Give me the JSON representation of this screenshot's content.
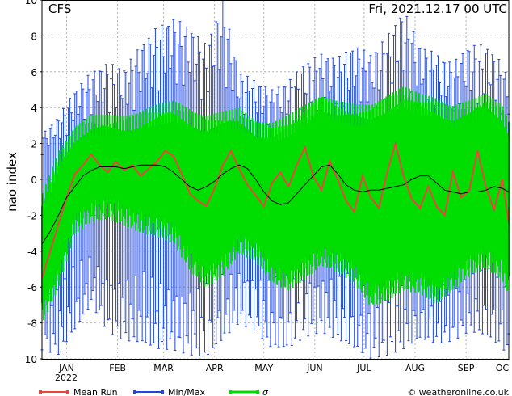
{
  "header": {
    "model": "CFS",
    "run_stamp": "Fri, 2021.12.17   00 UTC"
  },
  "footer": {
    "credit": "© weatheronline.co.uk"
  },
  "colors": {
    "mean": "#e8463c",
    "minmax": "#1e46e6",
    "sigma": "#00dd00",
    "ensemble_mean": "#000000",
    "grid": "#b4b4b4"
  },
  "chart_data": {
    "type": "line",
    "ylabel": "nao index",
    "ylim": [
      -10,
      10
    ],
    "y_ticks": [
      -10,
      -8,
      -6,
      -4,
      -2,
      0,
      2,
      4,
      6,
      8,
      10
    ],
    "xlim_days": [
      0,
      284
    ],
    "x_ticks": [
      {
        "label": "JAN",
        "day": 15
      },
      {
        "label": "FEB",
        "day": 46
      },
      {
        "label": "MAR",
        "day": 74
      },
      {
        "label": "APR",
        "day": 105
      },
      {
        "label": "MAY",
        "day": 135
      },
      {
        "label": "JUN",
        "day": 166
      },
      {
        "label": "JUL",
        "day": 196
      },
      {
        "label": "AUG",
        "day": 227
      },
      {
        "label": "SEP",
        "day": 258
      },
      {
        "label": "OC",
        "day": 288
      }
    ],
    "x_sublabel": "2022",
    "legend": [
      "Mean Run",
      "Min/Max",
      "σ"
    ],
    "series": [
      {
        "name": "Mean Run",
        "day": [
          0,
          5,
          10,
          15,
          20,
          25,
          30,
          35,
          40,
          45,
          50,
          55,
          60,
          65,
          70,
          75,
          80,
          85,
          90,
          95,
          100,
          105,
          110,
          115,
          120,
          125,
          130,
          135,
          140,
          145,
          150,
          155,
          160,
          165,
          170,
          175,
          180,
          185,
          190,
          195,
          200,
          205,
          210,
          215,
          220,
          225,
          230,
          235,
          240,
          245,
          250,
          255,
          260,
          265,
          270,
          275,
          280,
          284
        ],
        "values": [
          -5.5,
          -4.0,
          -2.5,
          -1.0,
          0.3,
          0.8,
          1.4,
          0.8,
          0.4,
          1.0,
          0.5,
          0.8,
          0.2,
          0.6,
          1.0,
          1.6,
          1.3,
          0.3,
          -0.8,
          -1.2,
          -1.5,
          -0.5,
          0.8,
          1.6,
          0.6,
          -0.3,
          -0.9,
          -1.5,
          -0.2,
          0.4,
          -0.4,
          0.8,
          1.8,
          0.2,
          -0.6,
          1.0,
          0.0,
          -1.2,
          -1.8,
          0.2,
          -1.0,
          -1.6,
          0.4,
          2.0,
          0.2,
          -1.1,
          -1.6,
          -0.4,
          -1.5,
          -2.0,
          0.4,
          -1.0,
          -0.6,
          1.6,
          -0.4,
          -1.7,
          0.0,
          -2.4
        ]
      },
      {
        "name": "ensemble mean",
        "day": [
          0,
          5,
          10,
          15,
          20,
          25,
          30,
          35,
          40,
          45,
          50,
          55,
          60,
          65,
          70,
          75,
          80,
          85,
          90,
          95,
          100,
          105,
          110,
          115,
          120,
          125,
          130,
          135,
          140,
          145,
          150,
          155,
          160,
          165,
          170,
          175,
          180,
          185,
          190,
          195,
          200,
          205,
          210,
          215,
          220,
          225,
          230,
          235,
          240,
          245,
          250,
          255,
          260,
          265,
          270,
          275,
          280,
          284
        ],
        "values": [
          -3.6,
          -2.9,
          -2.0,
          -1.0,
          -0.4,
          0.2,
          0.5,
          0.7,
          0.7,
          0.7,
          0.6,
          0.7,
          0.8,
          0.8,
          0.8,
          0.7,
          0.4,
          0.0,
          -0.4,
          -0.6,
          -0.4,
          -0.1,
          0.3,
          0.6,
          0.8,
          0.6,
          0.0,
          -0.7,
          -1.2,
          -1.4,
          -1.3,
          -0.8,
          -0.3,
          0.2,
          0.7,
          0.8,
          0.3,
          -0.3,
          -0.6,
          -0.7,
          -0.6,
          -0.6,
          -0.5,
          -0.4,
          -0.3,
          0.0,
          0.2,
          0.2,
          -0.2,
          -0.6,
          -0.7,
          -0.8,
          -0.7,
          -0.7,
          -0.6,
          -0.4,
          -0.5,
          -0.7
        ]
      },
      {
        "name": "σ band",
        "day": [
          0,
          10,
          20,
          30,
          40,
          50,
          60,
          70,
          80,
          90,
          100,
          110,
          120,
          130,
          140,
          150,
          160,
          170,
          180,
          190,
          200,
          210,
          220,
          230,
          240,
          250,
          260,
          270,
          280,
          284
        ],
        "upper": [
          -1.5,
          1.0,
          2.5,
          3.0,
          3.0,
          3.0,
          3.3,
          3.6,
          3.8,
          3.4,
          3.0,
          3.2,
          3.4,
          2.8,
          2.6,
          3.0,
          3.6,
          4.2,
          3.8,
          3.6,
          3.6,
          4.2,
          4.6,
          4.2,
          4.0,
          3.6,
          3.8,
          4.2,
          3.6,
          2.8
        ],
        "lower": [
          -7.5,
          -5.5,
          -2.5,
          -1.8,
          -1.6,
          -2.0,
          -2.4,
          -2.6,
          -3.0,
          -4.5,
          -5.5,
          -4.8,
          -3.6,
          -4.0,
          -5.2,
          -5.6,
          -5.0,
          -4.2,
          -4.6,
          -5.2,
          -6.5,
          -6.2,
          -5.6,
          -5.8,
          -6.4,
          -5.6,
          -4.8,
          -4.4,
          -5.0,
          -6.0
        ]
      },
      {
        "name": "Min/Max envelope",
        "day": [
          0,
          10,
          20,
          30,
          40,
          50,
          60,
          70,
          80,
          90,
          100,
          110,
          120,
          130,
          140,
          150,
          160,
          170,
          180,
          190,
          200,
          210,
          220,
          230,
          240,
          250,
          260,
          270,
          280,
          284
        ],
        "max": [
          2.5,
          3.5,
          5.0,
          6.0,
          6.5,
          6.2,
          7.5,
          8.5,
          9.0,
          8.5,
          7.5,
          10.0,
          6.0,
          5.5,
          5.0,
          5.5,
          6.5,
          7.0,
          6.8,
          7.5,
          7.0,
          8.0,
          9.5,
          7.5,
          7.0,
          6.5,
          7.5,
          7.5,
          6.5,
          5.5
        ],
        "min": [
          -9.5,
          -9.8,
          -8.5,
          -7.0,
          -8.5,
          -9.0,
          -9.2,
          -9.5,
          -9.5,
          -9.8,
          -10.0,
          -9.0,
          -8.0,
          -8.5,
          -9.5,
          -9.5,
          -8.8,
          -8.5,
          -9.0,
          -9.5,
          -10.0,
          -9.8,
          -9.5,
          -9.0,
          -9.2,
          -9.0,
          -8.5,
          -8.8,
          -9.5,
          -9.8
        ]
      }
    ]
  }
}
